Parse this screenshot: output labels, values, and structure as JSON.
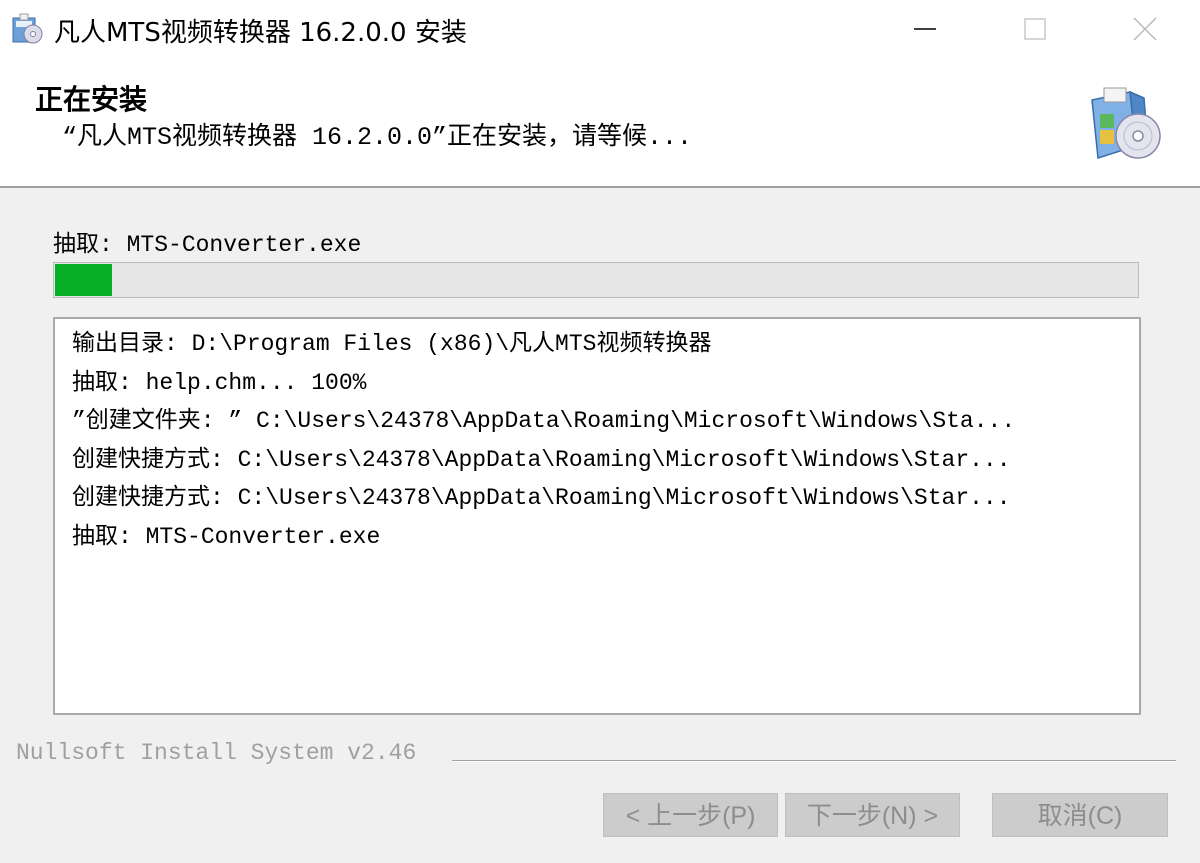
{
  "window": {
    "title": "凡人MTS视频转换器 16.2.0.0 安装",
    "minimize_icon": "minimize-icon",
    "maximize_icon": "maximize-icon",
    "close_icon": "close-icon"
  },
  "header": {
    "title": "正在安装",
    "subtitle": "“凡人MTS视频转换器 16.2.0.0”正在安装，请等候...",
    "icon": "installer-disc-icon"
  },
  "progress": {
    "status_text": "抽取: MTS-Converter.exe",
    "value_fraction": 0.053,
    "fill_color": "#06b025"
  },
  "log": {
    "lines": [
      "输出目录: D:\\Program Files (x86)\\凡人MTS视频转换器",
      "抽取: help.chm... 100%",
      "”创建文件夹: ” C:\\Users\\24378\\AppData\\Roaming\\Microsoft\\Windows\\Sta...",
      "创建快捷方式: C:\\Users\\24378\\AppData\\Roaming\\Microsoft\\Windows\\Star...",
      "创建快捷方式: C:\\Users\\24378\\AppData\\Roaming\\Microsoft\\Windows\\Star...",
      "抽取: MTS-Converter.exe"
    ]
  },
  "branding": {
    "text": "Nullsoft Install System v2.46"
  },
  "buttons": {
    "back_label": "< 上一步(P)",
    "next_label": "下一步(N) >",
    "cancel_label": "取消(C)"
  }
}
